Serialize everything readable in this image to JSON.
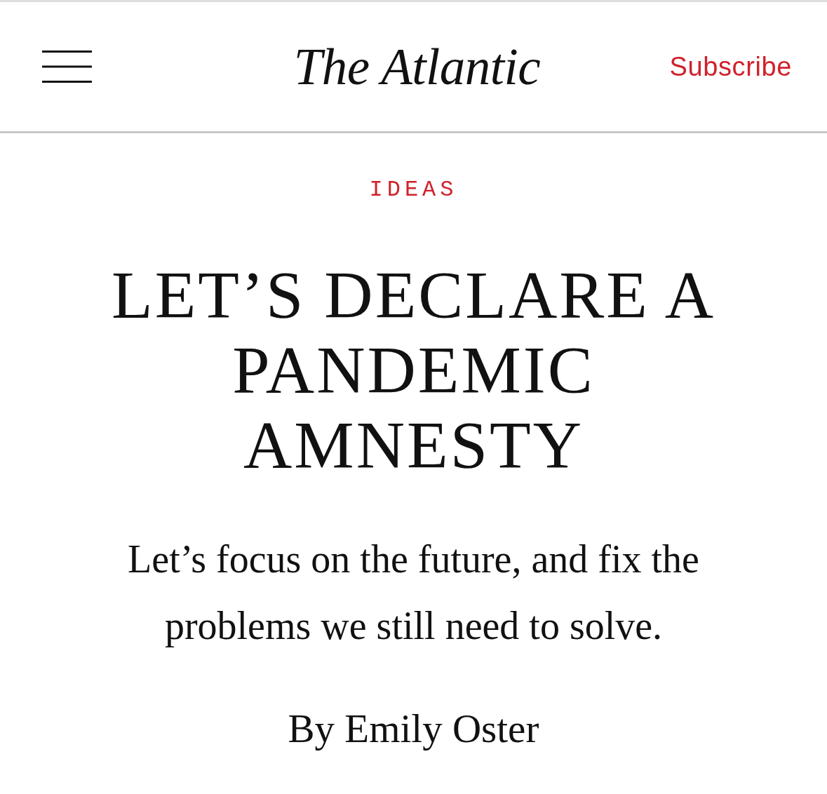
{
  "header": {
    "logo": "The Atlantic",
    "subscribe": "Subscribe"
  },
  "article": {
    "section": "IDEAS",
    "headline": "LET’S DECLARE A PANDEMIC AMNESTY",
    "dek": "Let’s focus on the future, and fix the problems we still need to solve.",
    "byline": "By Emily Oster"
  }
}
